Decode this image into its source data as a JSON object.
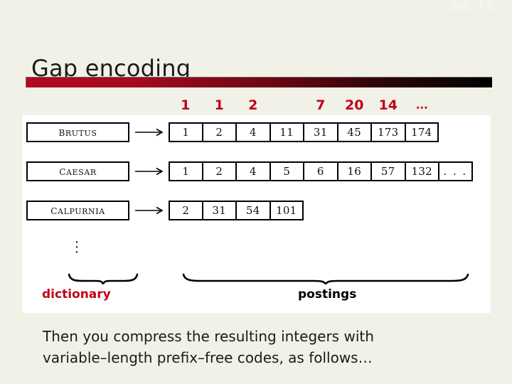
{
  "slide": {
    "section_marker": "Sec. 3.1",
    "title": "Gap encoding",
    "background_color": "#f2f1e8",
    "accent_color": "#c00018"
  },
  "gap_row": {
    "label": "gap-values",
    "values": [
      "1",
      "1",
      "2",
      "",
      "7",
      "20",
      "14",
      "…"
    ]
  },
  "figure": {
    "rows": [
      {
        "term": "Brutus",
        "arrow": "right-arrow",
        "postings": [
          "1",
          "2",
          "4",
          "11",
          "31",
          "45",
          "173",
          "174"
        ]
      },
      {
        "term": "Caesar",
        "arrow": "right-arrow",
        "postings": [
          "1",
          "2",
          "4",
          "5",
          "6",
          "16",
          "57",
          "132",
          ". . ."
        ]
      },
      {
        "term": "Calpurnia",
        "arrow": "right-arrow",
        "postings": [
          "2",
          "31",
          "54",
          "101"
        ]
      }
    ],
    "vertical_ellipsis": [
      "·",
      "·",
      "·"
    ],
    "dictionary_label": "dictionary",
    "postings_label": "postings"
  },
  "body": {
    "line1": "Then you compress the resulting integers with",
    "line2": "variable–length prefix–free codes, as follows…"
  }
}
